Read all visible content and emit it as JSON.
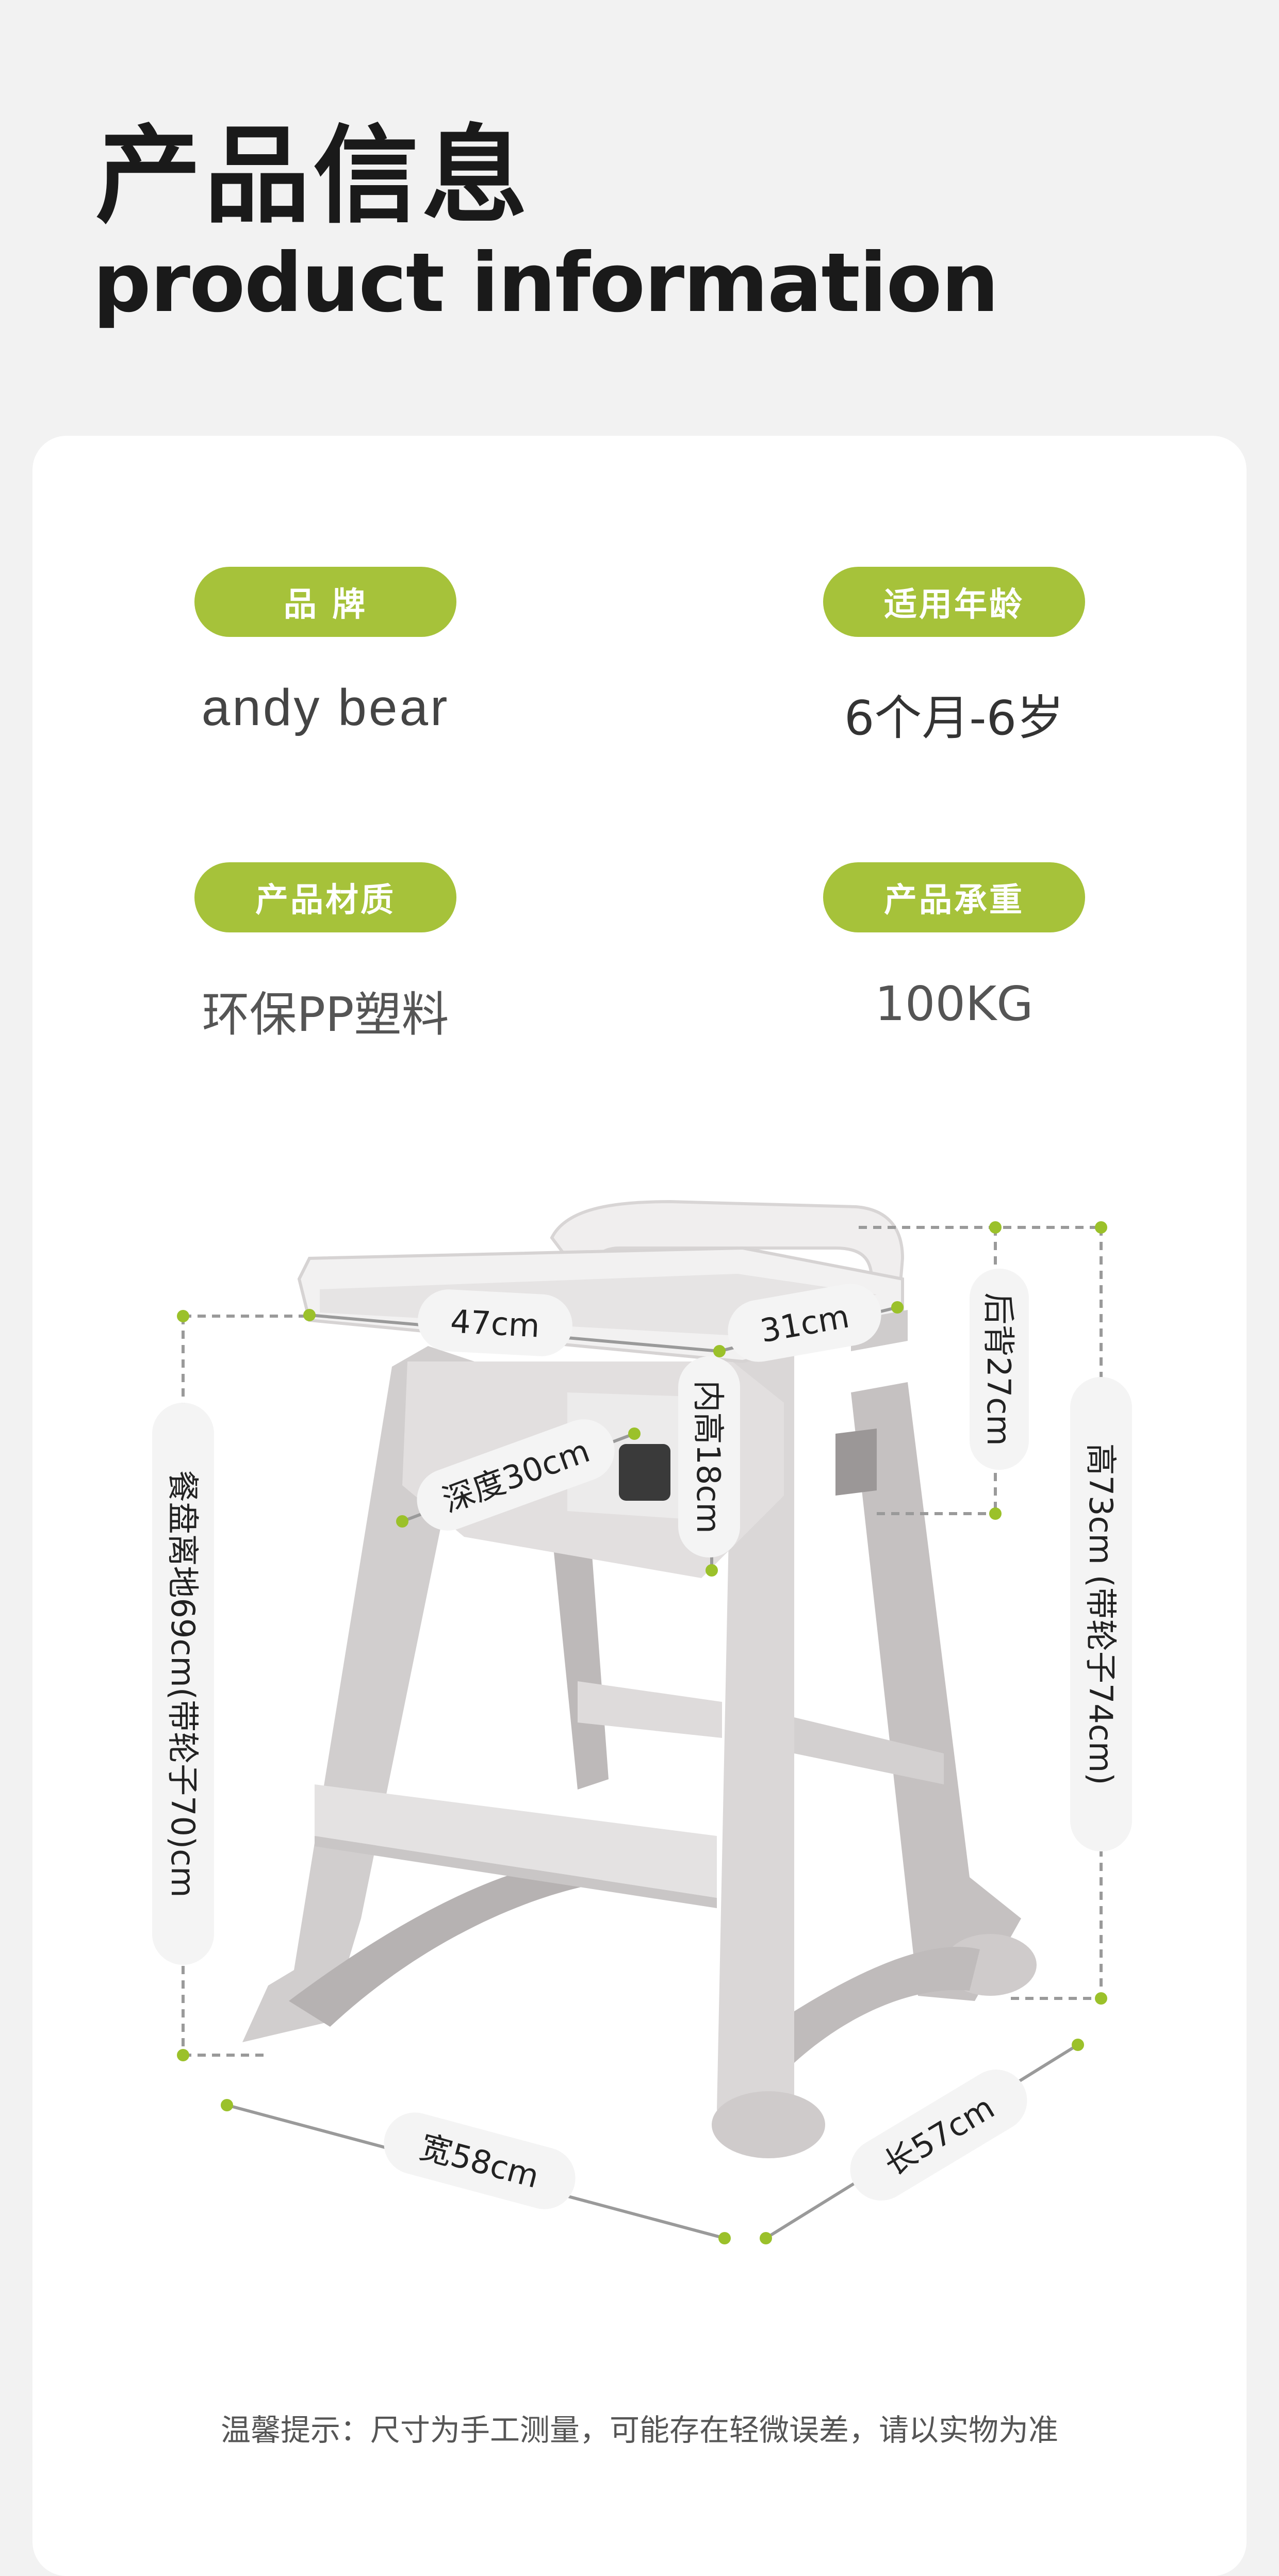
{
  "header": {
    "title_cn": "产品信息",
    "title_en": "product information"
  },
  "specs": {
    "brand_label": "品 牌",
    "brand_value": "andy bear",
    "age_label": "适用年龄",
    "age_value": "6个月-6岁",
    "material_label": "产品材质",
    "material_value": "环保PP塑料",
    "load_label": "产品承重",
    "load_value": "100KG"
  },
  "dimensions": {
    "tray_width": "47cm",
    "tray_depth": "31cm",
    "backrest": "后背27cm",
    "seat_depth": "深度30cm",
    "inner_height": "内高18cm",
    "tray_height": "餐盘离地69cm(带轮子70)cm",
    "total_height": "高73cm (带轮子74cm)",
    "width": "宽58cm",
    "length": "长57cm"
  },
  "note": "温馨提示：尺寸为手工测量，可能存在轻微误差，请以实物为准",
  "colors": {
    "accent": "#a6c23a",
    "dimension_line": "#999999",
    "chair": "#cfcccc"
  }
}
